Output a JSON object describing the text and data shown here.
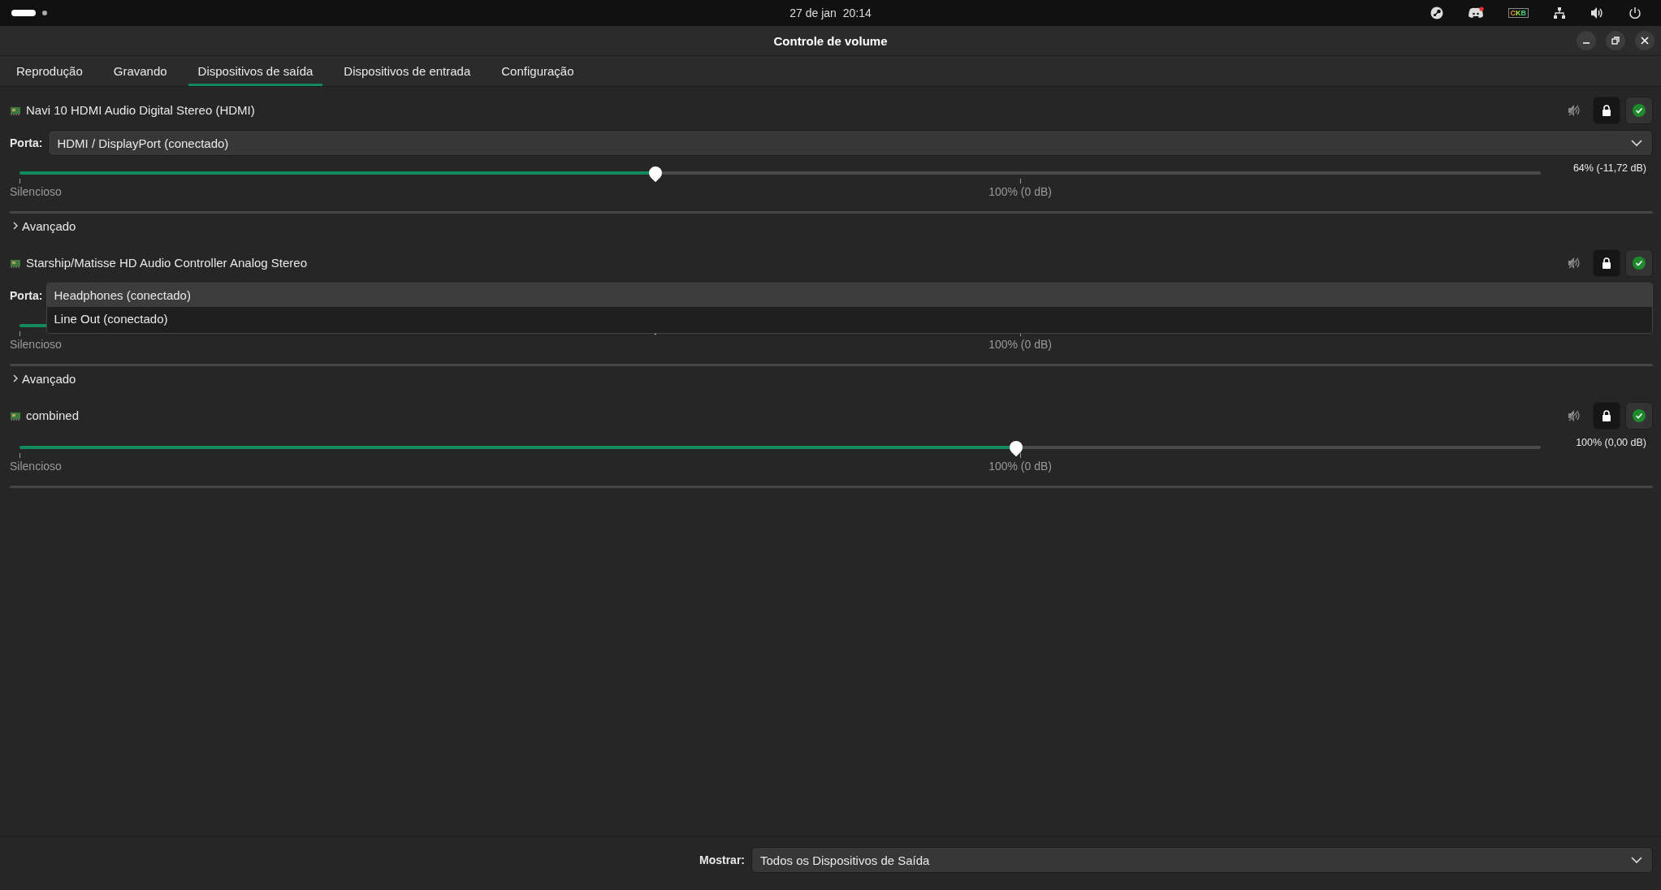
{
  "top_bar": {
    "datetime": "27 de jan  20:14",
    "tray_label": "CKB",
    "discord_notification": true
  },
  "window": {
    "title": "Controle de volume"
  },
  "tabs": [
    {
      "label": "Reprodução",
      "selected": false
    },
    {
      "label": "Gravando",
      "selected": false
    },
    {
      "label": "Dispositivos de saída",
      "selected": true
    },
    {
      "label": "Dispositivos de entrada",
      "selected": false
    },
    {
      "label": "Configuração",
      "selected": false
    }
  ],
  "devices": [
    {
      "name": "Navi 10 HDMI Audio Digital Stereo (HDMI)",
      "muted": false,
      "locked": true,
      "default": true,
      "port": {
        "label": "Porta:",
        "value": "HDMI / DisplayPort (conectado)"
      },
      "level": 0.418,
      "reading": "64% (-11,72 dB)",
      "min_label": "Silencioso",
      "mark_label": "100% (0 dB)",
      "advanced": {
        "label": "Avançado",
        "expanded": false
      }
    },
    {
      "name": "Starship/Matisse HD Audio Controller Analog Stereo",
      "muted": false,
      "locked": true,
      "default": true,
      "port": {
        "label": "Porta:",
        "open": true,
        "options": [
          {
            "label": "Headphones (conectado)",
            "selected": true
          },
          {
            "label": "Line Out (conectado)",
            "selected": false
          }
        ]
      },
      "level": 0.418,
      "min_label": "Silencioso",
      "mark_label": "100% (0 dB)",
      "advanced": {
        "label": "Avançado",
        "expanded": false
      }
    },
    {
      "name": "combined",
      "muted": false,
      "locked": true,
      "default": true,
      "level": 0.655,
      "reading": "100% (0,00 dB)",
      "min_label": "Silencioso",
      "mark_label": "100% (0 dB)"
    }
  ],
  "footer": {
    "label": "Mostrar:",
    "value": "Todos os Dispositivos de Saída"
  }
}
